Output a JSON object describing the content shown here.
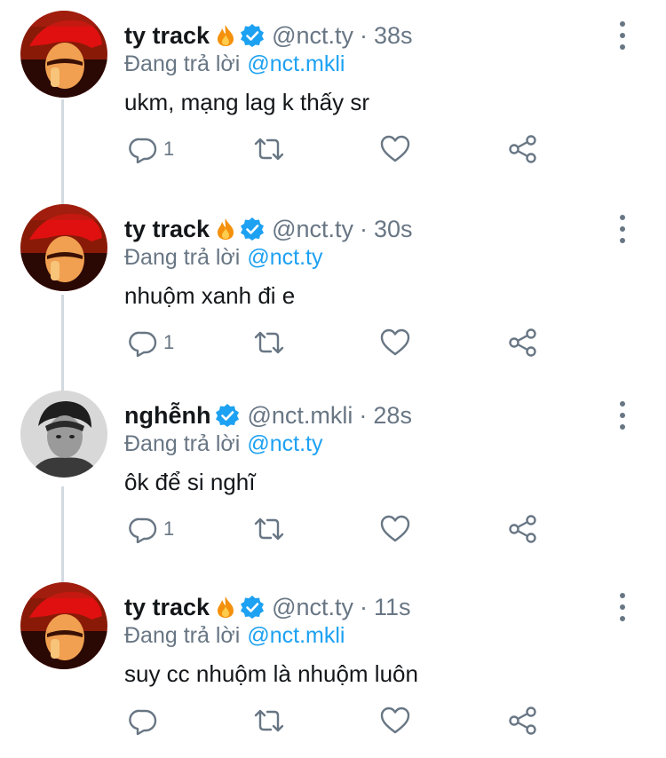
{
  "reply_prefix": "Đang trả lời",
  "colors": {
    "link": "#1da1f2",
    "secondary": "#687684",
    "verified": "#1da1f2",
    "fire": "#f4900c"
  },
  "tweets": [
    {
      "name": "ty track",
      "has_fire": true,
      "handle": "@nct.ty",
      "separator": "·",
      "time": "38s",
      "reply_to": "@nct.mkli",
      "text": "ukm, mạng lag k thấy sr",
      "reply_count": "1",
      "avatar": "avatar-red-cap"
    },
    {
      "name": "ty track",
      "has_fire": true,
      "handle": "@nct.ty",
      "separator": "·",
      "time": "30s",
      "reply_to": "@nct.ty",
      "text": "nhuộm xanh đi e",
      "reply_count": "1",
      "avatar": "avatar-red-cap"
    },
    {
      "name": "nghễnh",
      "has_fire": false,
      "handle": "@nct.mkli",
      "separator": "·",
      "time": "28s",
      "reply_to": "@nct.ty",
      "text": "ôk để si nghĩ",
      "reply_count": "1",
      "avatar": "avatar-grayscale"
    },
    {
      "name": "ty track",
      "has_fire": true,
      "handle": "@nct.ty",
      "separator": "·",
      "time": "11s",
      "reply_to": "@nct.mkli",
      "text": "suy cc nhuộm là nhuộm luôn",
      "reply_count": "",
      "avatar": "avatar-red-cap"
    }
  ]
}
